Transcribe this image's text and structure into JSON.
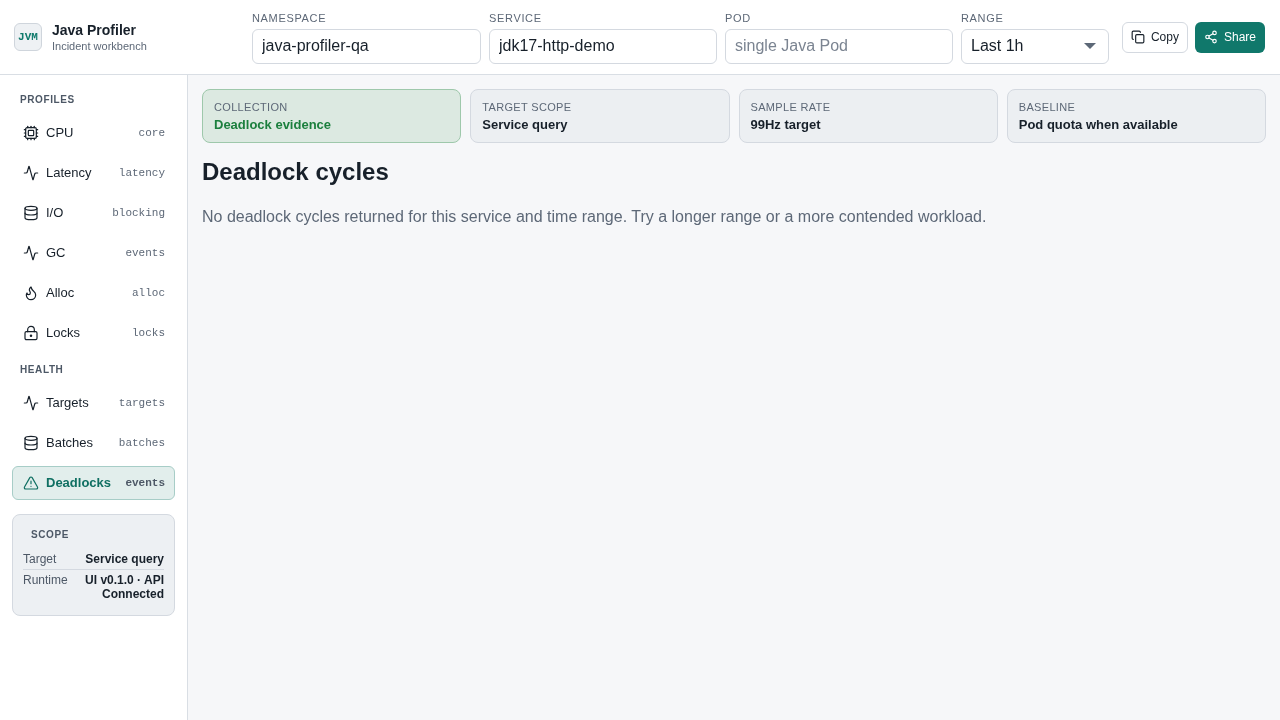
{
  "app": {
    "logo": "JVM",
    "title": "Java Profiler",
    "subtitle": "Incident workbench"
  },
  "filters": [
    {
      "kind": "text",
      "label": "NAMESPACE",
      "value": "java-profiler-qa"
    },
    {
      "kind": "text",
      "label": "SERVICE",
      "value": "jdk17-http-demo"
    },
    {
      "kind": "text",
      "label": "POD",
      "placeholder": "single Java Pod"
    },
    {
      "kind": "select",
      "label": "RANGE",
      "value": "Last 1h"
    }
  ],
  "actions": [
    {
      "kind": "secondary",
      "label": "Copy"
    },
    {
      "kind": "primary",
      "label": "Share"
    }
  ],
  "sidebar": {
    "sections": [
      {
        "title": "PROFILES",
        "items": [
          {
            "label": "CPU",
            "tag": "core",
            "selected": false
          },
          {
            "label": "Latency",
            "tag": "latency",
            "selected": false
          },
          {
            "label": "I/O",
            "tag": "blocking",
            "selected": false
          },
          {
            "label": "GC",
            "tag": "events",
            "selected": false
          },
          {
            "label": "Alloc",
            "tag": "alloc",
            "selected": false
          },
          {
            "label": "Locks",
            "tag": "locks",
            "selected": false
          }
        ]
      },
      {
        "title": "HEALTH",
        "items": [
          {
            "label": "Targets",
            "tag": "targets",
            "selected": false
          },
          {
            "label": "Batches",
            "tag": "batches",
            "selected": false
          },
          {
            "label": "Deadlocks",
            "tag": "events",
            "selected": true
          }
        ]
      }
    ],
    "scope": {
      "title": "SCOPE",
      "rows": [
        {
          "label": "Target",
          "value": "Service query"
        },
        {
          "label": "Runtime",
          "value": "UI v0.1.0 · API Connected"
        }
      ]
    }
  },
  "summary_cards": [
    {
      "label": "COLLECTION",
      "value": "Deadlock evidence",
      "highlighted": true
    },
    {
      "label": "TARGET SCOPE",
      "value": "Service query",
      "highlighted": false
    },
    {
      "label": "SAMPLE RATE",
      "value": "99Hz target",
      "highlighted": false
    },
    {
      "label": "BASELINE",
      "value": "Pod quota when available",
      "highlighted": false
    }
  ],
  "content": {
    "title": "Deadlock cycles",
    "message": "No deadlock cycles returned for this service and time range. Try a longer range or a more contended workload."
  }
}
